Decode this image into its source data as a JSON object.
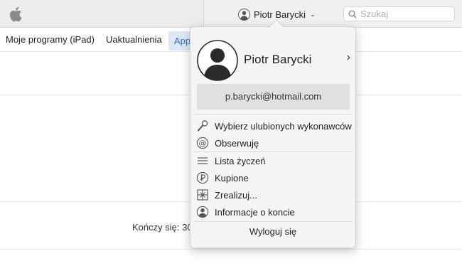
{
  "toolbar": {
    "account_name": "Piotr Barycki",
    "search_placeholder": "Szukaj"
  },
  "nav": {
    "tabs": [
      {
        "label": "Moje programy (iPad)"
      },
      {
        "label": "Uaktualnienia"
      },
      {
        "label": "App"
      }
    ]
  },
  "background": {
    "ends_text": "Kończy się: 30"
  },
  "popover": {
    "name": "Piotr Barycki",
    "email": "p.barycki@hotmail.com",
    "menu": [
      {
        "label": "Wybierz ulubionych wykonawców",
        "icon": "microphone-icon"
      },
      {
        "label": "Obserwuję",
        "icon": "at-sign-icon"
      },
      {
        "label": "Lista życzeń",
        "icon": "list-icon"
      },
      {
        "label": "Kupione",
        "icon": "purchased-icon"
      },
      {
        "label": "Zrealizuj...",
        "icon": "gift-icon"
      },
      {
        "label": "Informacje o koncie",
        "icon": "account-icon"
      }
    ],
    "logout_label": "Wyloguj się"
  },
  "colors": {
    "accent": "#2c6fc9",
    "tab_active_bg": "#dde8f6"
  }
}
